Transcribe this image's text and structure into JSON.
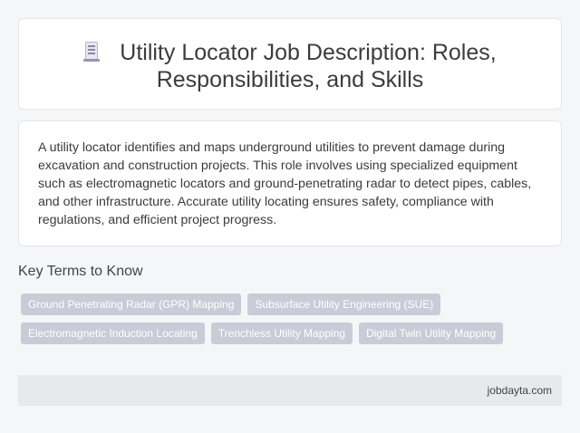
{
  "header": {
    "icon": "document-icon",
    "title_line1": "Utility Locator Job Description: Roles,",
    "title_line2": "Responsibilities, and Skills"
  },
  "description": {
    "text": "A utility locator identifies and maps underground utilities to prevent damage during excavation and construction projects. This role involves using specialized equipment such as electromagnetic locators and ground-penetrating radar to detect pipes, cables, and other infrastructure. Accurate utility locating ensures safety, compliance with regulations, and efficient project progress."
  },
  "key_terms": {
    "title": "Key Terms to Know",
    "tags": [
      "Ground Penetrating Radar (GPR) Mapping",
      "Subsurface Utility Engineering (SUE)",
      "Electromagnetic Induction Locating",
      "Trenchless Utility Mapping",
      "Digital Twin Utility Mapping"
    ]
  },
  "footer": {
    "site": "jobdayta.com"
  },
  "colors": {
    "tag_background": "#c9ccd6",
    "footer_background": "#e6eaed",
    "page_background": "#f5f6f8"
  }
}
